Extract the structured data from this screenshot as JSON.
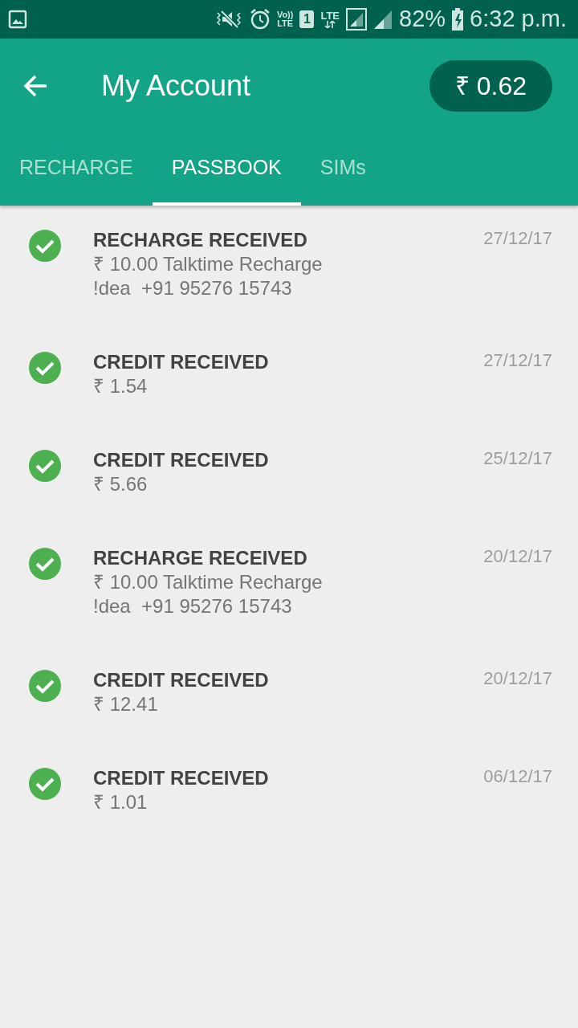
{
  "status_bar": {
    "volte": [
      "Vo))",
      "LTE"
    ],
    "sim_slot": "1",
    "network": "LTE",
    "battery": "82%",
    "time": "6:32 p.m."
  },
  "app_bar": {
    "title": "My Account",
    "balance": "₹ 0.62"
  },
  "tabs": [
    {
      "label": "RECHARGE",
      "selected": false
    },
    {
      "label": "PASSBOOK",
      "selected": true
    },
    {
      "label": "SIMs",
      "selected": false
    }
  ],
  "transactions": [
    {
      "title": "RECHARGE RECEIVED",
      "lines": [
        "₹ 10.00 Talktime Recharge",
        "!dea  +91 95276 15743"
      ],
      "date": "27/12/17"
    },
    {
      "title": "CREDIT RECEIVED",
      "lines": [
        "₹ 1.54"
      ],
      "date": "27/12/17"
    },
    {
      "title": "CREDIT RECEIVED",
      "lines": [
        "₹ 5.66"
      ],
      "date": "25/12/17"
    },
    {
      "title": "RECHARGE RECEIVED",
      "lines": [
        "₹ 10.00 Talktime Recharge",
        "!dea  +91 95276 15743"
      ],
      "date": "20/12/17"
    },
    {
      "title": "CREDIT RECEIVED",
      "lines": [
        "₹ 12.41"
      ],
      "date": "20/12/17"
    },
    {
      "title": "CREDIT RECEIVED",
      "lines": [
        "₹ 1.01"
      ],
      "date": "06/12/17"
    }
  ]
}
